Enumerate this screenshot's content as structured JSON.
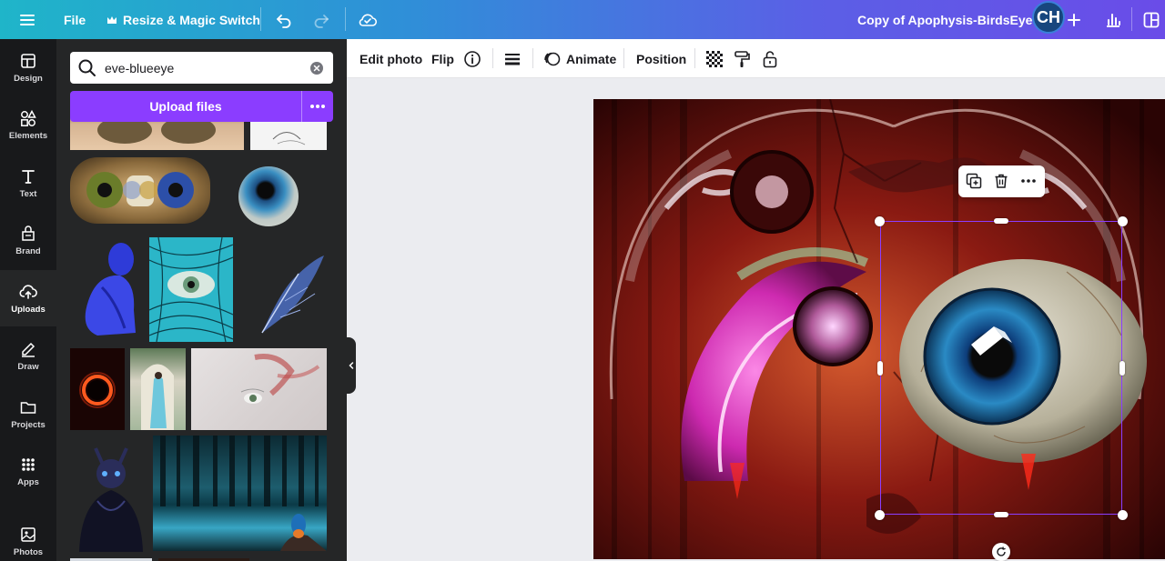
{
  "topbar": {
    "menu_icon": "hamburger-menu-icon",
    "file_label": "File",
    "resize_label": "Resize & Magic Switch",
    "doc_title": "Copy of Apophysis-BirdsEye",
    "avatar_initials": "CH",
    "gradient_colors": [
      "#1fb5c9",
      "#6a4ce8"
    ]
  },
  "rail": {
    "items": [
      {
        "label": "Design",
        "icon": "design-icon"
      },
      {
        "label": "Elements",
        "icon": "elements-icon"
      },
      {
        "label": "Text",
        "icon": "text-icon"
      },
      {
        "label": "Brand",
        "icon": "brand-icon"
      },
      {
        "label": "Uploads",
        "icon": "cloud-upload-icon",
        "active": true
      },
      {
        "label": "Draw",
        "icon": "draw-icon"
      },
      {
        "label": "Projects",
        "icon": "folder-icon"
      },
      {
        "label": "Apps",
        "icon": "apps-icon"
      },
      {
        "label": "Photos",
        "icon": "photo-icon"
      }
    ]
  },
  "panel": {
    "search_value": "eve-blueeye",
    "upload_label": "Upload files",
    "accent": "#8b3dff"
  },
  "context_toolbar": {
    "edit_photo": "Edit photo",
    "flip": "Flip",
    "animate": "Animate",
    "position": "Position"
  }
}
